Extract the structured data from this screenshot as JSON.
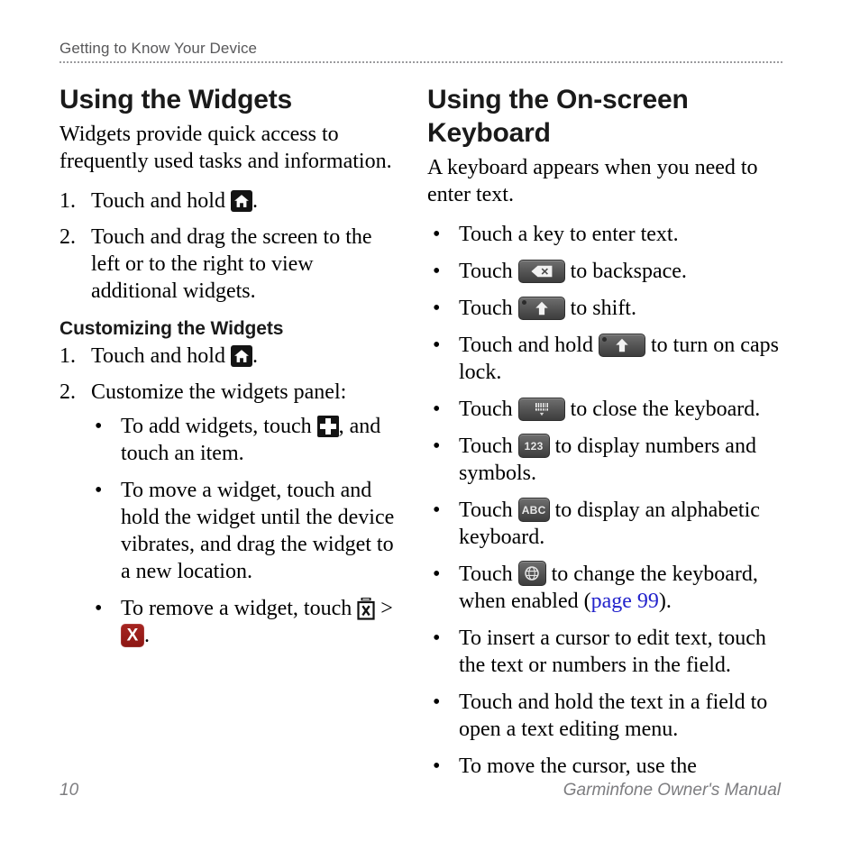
{
  "page": {
    "running_header": "Getting to Know Your Device",
    "page_number": "10",
    "manual_title": "Garminfone Owner's Manual"
  },
  "left_column": {
    "title": "Using the Widgets",
    "intro": "Widgets provide quick access to frequently used tasks and information.",
    "steps": [
      {
        "num": "1.",
        "text_before": "Touch and hold ",
        "icon": "home-icon",
        "text_after": "."
      },
      {
        "num": "2.",
        "text_before": "Touch and drag the screen to the left or to the right to view additional widgets.",
        "icon": "",
        "text_after": ""
      }
    ],
    "subtitle": "Customizing the Widgets",
    "custom_steps": [
      {
        "num": "1.",
        "text_before": "Touch and hold ",
        "icon": "home-icon",
        "text_after": "."
      },
      {
        "num": "2.",
        "text_before": "Customize the widgets panel:",
        "icon": "",
        "text_after": ""
      }
    ],
    "custom_bullets": [
      {
        "text_before": "To add widgets, touch ",
        "icon": "plus-icon",
        "text_after": ", and touch an item."
      },
      {
        "text_before": "To move a widget, touch and hold the widget until the device vibrates, and drag the widget to a new location.",
        "icon": "",
        "text_after": ""
      },
      {
        "text_before": "To remove a widget, touch ",
        "icon": "trash-x-icon",
        "text_mid": " > ",
        "icon2": "red-x-icon",
        "text_after": "."
      }
    ]
  },
  "right_column": {
    "title": "Using the On-screen Keyboard",
    "intro": "A keyboard appears when you need to enter text.",
    "bullets": [
      {
        "text_before": "Touch a key to enter text.",
        "icon": "",
        "text_after": ""
      },
      {
        "text_before": "Touch ",
        "icon": "backspace-key",
        "text_after": " to backspace."
      },
      {
        "text_before": "Touch ",
        "icon": "shift-key",
        "text_after": " to shift."
      },
      {
        "text_before": "Touch and hold ",
        "icon": "shift-key",
        "text_after": " to turn on caps lock."
      },
      {
        "text_before": "Touch ",
        "icon": "close-keyboard-key",
        "text_after": " to close the keyboard."
      },
      {
        "text_before": "Touch ",
        "icon": "numbers-key",
        "icon_label": "123",
        "text_after": " to display numbers and symbols."
      },
      {
        "text_before": "Touch ",
        "icon": "alphabetic-key",
        "icon_label": "ABC",
        "text_after": " to display an alphabetic keyboard."
      },
      {
        "text_before": "Touch ",
        "icon": "change-keyboard-key",
        "text_after": " to change the keyboard, when enabled (",
        "link": "page 99",
        "text_tail": ")."
      },
      {
        "text_before": "To insert a cursor to edit text, touch the text or numbers in the field.",
        "icon": "",
        "text_after": ""
      },
      {
        "text_before": "Touch and hold the text in a field to open a text editing menu.",
        "icon": "",
        "text_after": ""
      },
      {
        "text_before": "To move the cursor, use the",
        "icon": "",
        "text_after": ""
      }
    ]
  },
  "colors": {
    "header_gray": "#58585a",
    "footer_gray": "#7d7d80",
    "link_blue": "#2222cc",
    "icon_black": "#141414",
    "icon_red": "#9e1f1b",
    "key_gray": "#565656"
  }
}
